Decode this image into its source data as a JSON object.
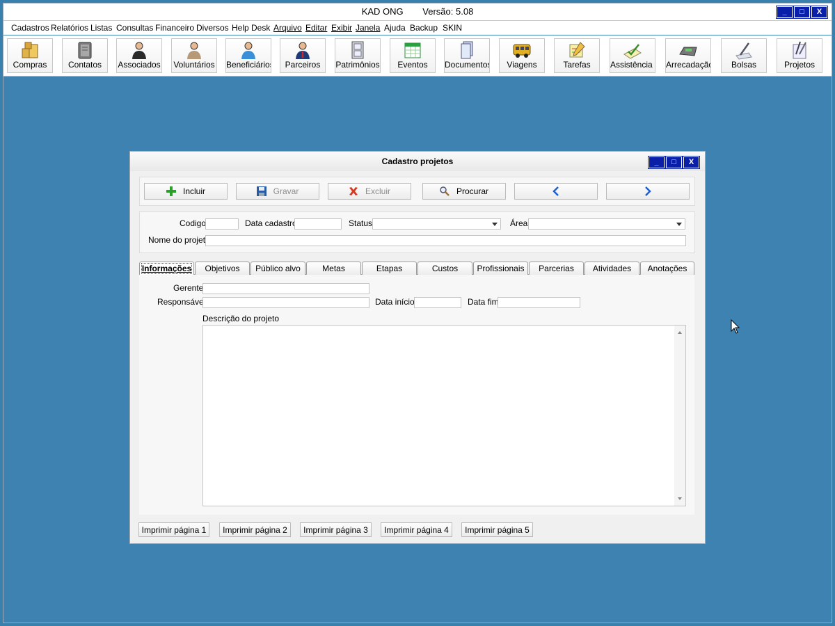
{
  "app": {
    "title": "KAD ONG",
    "version": "Versão: 5.08"
  },
  "window_buttons": {
    "minimize": "_",
    "maximize": "□",
    "close": "X"
  },
  "menu": [
    "Cadastros",
    "Relatórios",
    "Listas",
    "Consultas",
    "Financeiro",
    "Diversos",
    "Help Desk",
    "Arquivo",
    "Editar",
    "Exibir",
    "Janela",
    "Ajuda",
    "Backup",
    "SKIN"
  ],
  "toolbar": [
    {
      "label": "Compras",
      "icon": "boxes-icon"
    },
    {
      "label": "Contatos",
      "icon": "address-book-icon"
    },
    {
      "label": "Associados",
      "icon": "person-suit-icon"
    },
    {
      "label": "Voluntários",
      "icon": "person-icon"
    },
    {
      "label": "Beneficiários",
      "icon": "person-blue-icon"
    },
    {
      "label": "Parceiros",
      "icon": "person-tie-icon"
    },
    {
      "label": "Patrimônios",
      "icon": "cabinet-icon"
    },
    {
      "label": "Eventos",
      "icon": "calendar-icon"
    },
    {
      "label": "Documentos",
      "icon": "documents-icon"
    },
    {
      "label": "Viagens",
      "icon": "bus-icon"
    },
    {
      "label": "Tarefas",
      "icon": "notepad-pencil-icon"
    },
    {
      "label": "Assistência S",
      "icon": "checkmark-paper-icon"
    },
    {
      "label": "Arrecadação",
      "icon": "cash-register-icon"
    },
    {
      "label": "Bolsas",
      "icon": "pen-icon"
    },
    {
      "label": "Projetos",
      "icon": "pens-icon"
    }
  ],
  "dialog": {
    "title": "Cadastro projetos",
    "actions": {
      "incluir": "Incluir",
      "gravar": "Gravar",
      "excluir": "Excluir",
      "procurar": "Procurar"
    },
    "fields": {
      "codigo": "Codigo",
      "data_cadastro": "Data cadastro",
      "status": "Status",
      "area": "Área",
      "nome_projeto": "Nome do projeto",
      "gerente": "Gerente",
      "responsavel": "Responsável",
      "data_inicio": "Data início",
      "data_fim": "Data fim",
      "descricao": "Descrição do projeto"
    },
    "tabs": [
      "Informações",
      "Objetivos",
      "Público alvo",
      "Metas",
      "Etapas",
      "Custos",
      "Profissionais",
      "Parcerias",
      "Atividades",
      "Anotações"
    ],
    "print_buttons": [
      "Imprimir página 1",
      "Imprimir página 2",
      "Imprimir página 3",
      "Imprimir página 4",
      "Imprimir página 5"
    ]
  },
  "colors": {
    "desktop": "#3a80ad",
    "title_button": "#0a1fa8",
    "add_green": "#2aa02a",
    "delete_red": "#d83a20",
    "nav_blue": "#1a5fd0"
  }
}
